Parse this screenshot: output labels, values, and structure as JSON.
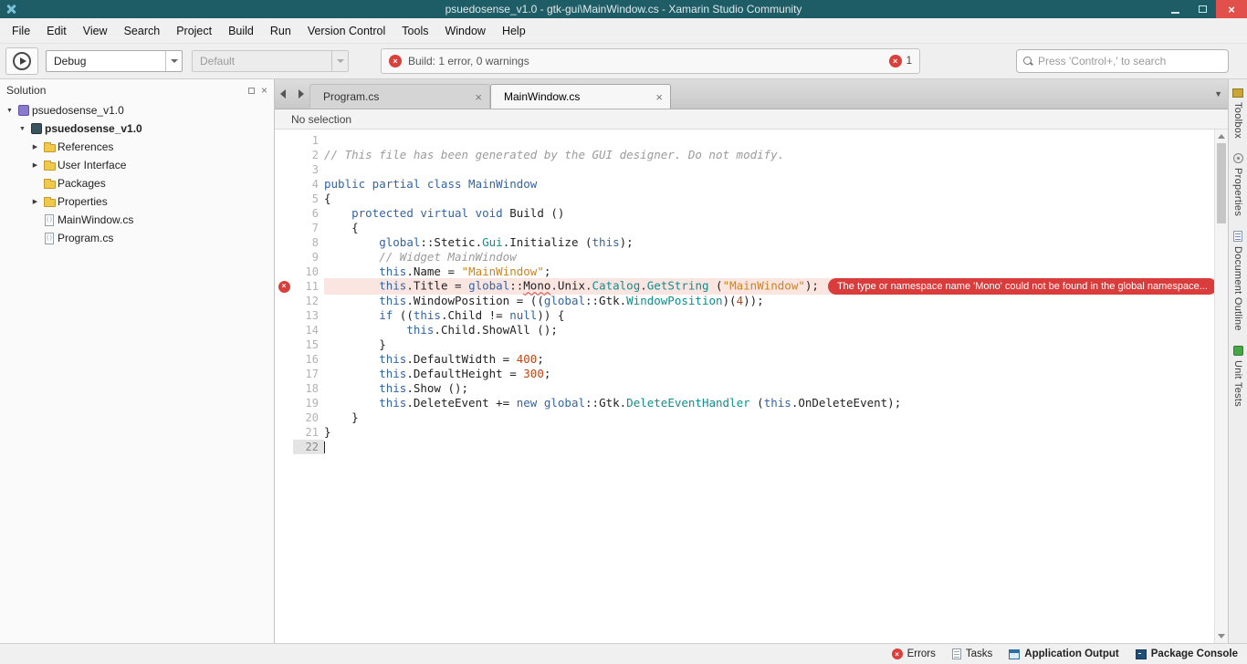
{
  "window": {
    "title": "psuedosense_v1.0 - gtk-gui\\MainWindow.cs - Xamarin Studio Community"
  },
  "icons": {
    "window_close": "×",
    "error_x": "×",
    "tab_close": "×",
    "pad_close": "×",
    "expander_expanded": "▼",
    "expander_collapsed": "▶",
    "tab_overflow": "▼"
  },
  "menu": {
    "items": [
      "File",
      "Edit",
      "View",
      "Search",
      "Project",
      "Build",
      "Run",
      "Version Control",
      "Tools",
      "Window",
      "Help"
    ]
  },
  "toolbar": {
    "configuration": "Debug",
    "device": "Default",
    "build_status": "Build: 1 error, 0 warnings",
    "error_badge": "1",
    "search_placeholder": "Press 'Control+,' to search"
  },
  "solution_pad": {
    "title": "Solution",
    "items": [
      {
        "label": "psuedosense_v1.0",
        "icon": "solution",
        "level": 0,
        "expander": "expanded",
        "bold": false
      },
      {
        "label": "psuedosense_v1.0",
        "icon": "project",
        "level": 1,
        "expander": "expanded",
        "bold": true
      },
      {
        "label": "References",
        "icon": "references-folder",
        "level": 2,
        "expander": "collapsed",
        "bold": false
      },
      {
        "label": "User Interface",
        "icon": "folder",
        "level": 2,
        "expander": "collapsed",
        "bold": false
      },
      {
        "label": "Packages",
        "icon": "folder",
        "level": 2,
        "expander": "none",
        "bold": false
      },
      {
        "label": "Properties",
        "icon": "folder",
        "level": 2,
        "expander": "collapsed",
        "bold": false
      },
      {
        "label": "MainWindow.cs",
        "icon": "csfile",
        "level": 2,
        "expander": "none",
        "bold": false
      },
      {
        "label": "Program.cs",
        "icon": "csfile",
        "level": 2,
        "expander": "none",
        "bold": false
      }
    ]
  },
  "editor": {
    "tabs": [
      {
        "label": "Program.cs",
        "active": false
      },
      {
        "label": "MainWindow.cs",
        "active": true
      }
    ],
    "breadcrumb": "No selection",
    "error_tooltip": "The type or namespace name 'Mono' could not be found in the global namespace...",
    "lines": [
      {
        "n": 1,
        "i": 0,
        "seg": []
      },
      {
        "n": 2,
        "i": 0,
        "seg": [
          [
            "c",
            "// This file has been generated by the GUI designer. Do not modify."
          ]
        ]
      },
      {
        "n": 3,
        "i": 0,
        "seg": []
      },
      {
        "n": 4,
        "i": 0,
        "seg": [
          [
            "k",
            "public partial class MainWindow"
          ]
        ]
      },
      {
        "n": 5,
        "i": 0,
        "seg": [
          [
            "p",
            "{"
          ]
        ]
      },
      {
        "n": 6,
        "i": 1,
        "seg": [
          [
            "k",
            "protected virtual void"
          ],
          [
            "p",
            " Build ()"
          ]
        ]
      },
      {
        "n": 7,
        "i": 1,
        "seg": [
          [
            "p",
            "{"
          ]
        ]
      },
      {
        "n": 8,
        "i": 2,
        "seg": [
          [
            "k",
            "global"
          ],
          [
            "p",
            "::Stetic."
          ],
          [
            "t",
            "Gui"
          ],
          [
            "p",
            ".Initialize ("
          ],
          [
            "k",
            "this"
          ],
          [
            "p",
            ");"
          ]
        ]
      },
      {
        "n": 9,
        "i": 2,
        "seg": [
          [
            "c",
            "// Widget MainWindow"
          ]
        ]
      },
      {
        "n": 10,
        "i": 2,
        "seg": [
          [
            "k",
            "this"
          ],
          [
            "p",
            ".Name = "
          ],
          [
            "s",
            "\"MainWindow\""
          ],
          [
            "p",
            ";"
          ]
        ]
      },
      {
        "n": 11,
        "i": 2,
        "error": true,
        "seg": [
          [
            "k",
            "this"
          ],
          [
            "p",
            ".Title = "
          ],
          [
            "k",
            "global"
          ],
          [
            "p",
            "::"
          ],
          [
            "e",
            "Mono"
          ],
          [
            "p",
            ".Unix."
          ],
          [
            "t",
            "Catalog"
          ],
          [
            "p",
            "."
          ],
          [
            "t",
            "GetString"
          ],
          [
            "p",
            " ("
          ],
          [
            "s",
            "\"MainWindow\""
          ],
          [
            "p",
            ");"
          ]
        ]
      },
      {
        "n": 12,
        "i": 2,
        "seg": [
          [
            "k",
            "this"
          ],
          [
            "p",
            ".WindowPosition = (("
          ],
          [
            "k",
            "global"
          ],
          [
            "p",
            "::Gtk."
          ],
          [
            "t",
            "WindowPosition"
          ],
          [
            "p",
            ")("
          ],
          [
            "n",
            "4"
          ],
          [
            "p",
            "));"
          ]
        ]
      },
      {
        "n": 13,
        "i": 2,
        "seg": [
          [
            "k",
            "if"
          ],
          [
            "p",
            " (("
          ],
          [
            "k",
            "this"
          ],
          [
            "p",
            ".Child != "
          ],
          [
            "k",
            "null"
          ],
          [
            "p",
            ")) {"
          ]
        ]
      },
      {
        "n": 14,
        "i": 3,
        "seg": [
          [
            "k",
            "this"
          ],
          [
            "p",
            ".Child.ShowAll ();"
          ]
        ]
      },
      {
        "n": 15,
        "i": 2,
        "seg": [
          [
            "p",
            "}"
          ]
        ]
      },
      {
        "n": 16,
        "i": 2,
        "seg": [
          [
            "k",
            "this"
          ],
          [
            "p",
            ".DefaultWidth = "
          ],
          [
            "n",
            "400"
          ],
          [
            "p",
            ";"
          ]
        ]
      },
      {
        "n": 17,
        "i": 2,
        "seg": [
          [
            "k",
            "this"
          ],
          [
            "p",
            ".DefaultHeight = "
          ],
          [
            "n",
            "300"
          ],
          [
            "p",
            ";"
          ]
        ]
      },
      {
        "n": 18,
        "i": 2,
        "seg": [
          [
            "k",
            "this"
          ],
          [
            "p",
            ".Show ();"
          ]
        ]
      },
      {
        "n": 19,
        "i": 2,
        "seg": [
          [
            "k",
            "this"
          ],
          [
            "p",
            ".DeleteEvent += "
          ],
          [
            "k",
            "new"
          ],
          [
            "p",
            " "
          ],
          [
            "k",
            "global"
          ],
          [
            "p",
            "::Gtk."
          ],
          [
            "t",
            "DeleteEventHandler"
          ],
          [
            "p",
            " ("
          ],
          [
            "k",
            "this"
          ],
          [
            "p",
            ".OnDeleteEvent);"
          ]
        ]
      },
      {
        "n": 20,
        "i": 1,
        "seg": [
          [
            "p",
            "}"
          ]
        ]
      },
      {
        "n": 21,
        "i": 0,
        "seg": [
          [
            "p",
            "}"
          ]
        ]
      },
      {
        "n": 22,
        "i": 0,
        "cursor": true,
        "seg": []
      }
    ]
  },
  "right_sidebar": {
    "tabs": [
      {
        "label": "Toolbox",
        "icon": "toolbox"
      },
      {
        "label": "Properties",
        "icon": "properties"
      },
      {
        "label": "Document Outline",
        "icon": "document-outline"
      },
      {
        "label": "Unit Tests",
        "icon": "unit-tests"
      }
    ]
  },
  "status_bar": {
    "items": [
      {
        "label": "Errors",
        "icon": "errors",
        "emphasis": false
      },
      {
        "label": "Tasks",
        "icon": "tasks",
        "emphasis": false
      },
      {
        "label": "Application Output",
        "icon": "application-output",
        "emphasis": true
      },
      {
        "label": "Package Console",
        "icon": "package-console",
        "emphasis": true
      }
    ]
  }
}
